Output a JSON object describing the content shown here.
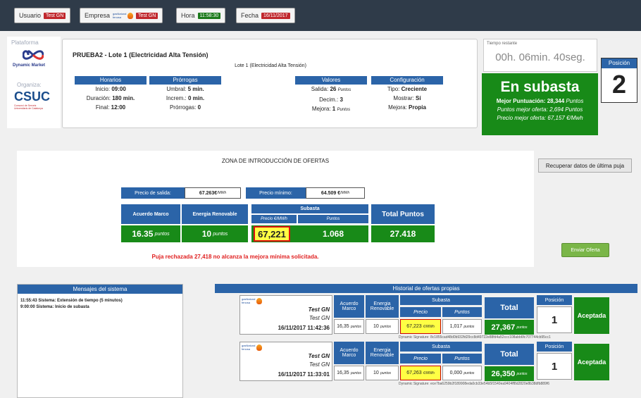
{
  "topbar": {
    "user": {
      "label": "Usuario",
      "value": "Test GN"
    },
    "company": {
      "label": "Empresa",
      "logo": "gasNatural fenosa",
      "value": "Test GN"
    },
    "time": {
      "label": "Hora",
      "value": "11:58:30"
    },
    "date": {
      "label": "Fecha",
      "value": "16/11/2017"
    }
  },
  "brand": {
    "platform_label": "Plataforma",
    "platform_name": "Dynamic Market",
    "organizer_label": "Organiza:",
    "organizer_name": "CSUC",
    "organizer_sub": "Consorci de Serveis Universitaris de Catalunya"
  },
  "auction": {
    "title": "PRUEBA2 - Lote 1 (Electricidad Alta Tensión)",
    "subtitle": "Lote 1 (Electricidad Alta Tensión)",
    "horarios": {
      "header": "Horarios",
      "inicio_label": "Inicio:",
      "inicio": "09:00",
      "duracion_label": "Duración:",
      "duracion": "180 min.",
      "final_label": "Final:",
      "final": "12:00"
    },
    "prorrogas": {
      "header": "Prórrogas",
      "umbral_label": "Umbral:",
      "umbral": "5 min.",
      "increm_label": "Increm.:",
      "increm": "0 min.",
      "prorrogas_label": "Prórrogas:",
      "prorrogas": "0"
    },
    "valores": {
      "header": "Valores",
      "salida_label": "Salida:",
      "salida": "26",
      "salida_unit": "Puntos",
      "decim_label": "Decim.:",
      "decim": "3",
      "mejora_label": "Mejora:",
      "mejora": "1",
      "mejora_unit": "Puntos"
    },
    "config": {
      "header": "Configuración",
      "tipo_label": "Tipo:",
      "tipo": "Creciente",
      "mostrar_label": "Mostrar:",
      "mostrar": "Sí",
      "mejora_label": "Mejora:",
      "mejora": "Propia"
    }
  },
  "timer": {
    "label": "Tiempo restante",
    "value": "00h. 06min. 40seg."
  },
  "status": {
    "title": "En subasta",
    "best_score_label": "Mejor Puntuación:",
    "best_score": "28,344",
    "best_score_unit": "Puntos",
    "best_offer_points_label": "Puntos mejor oferta:",
    "best_offer_points": "2,694 Puntos",
    "best_price_label": "Precio mejor oferta:",
    "best_price": "67,157 €/Mwh"
  },
  "position": {
    "label": "Posición",
    "value": "2"
  },
  "zone": {
    "title": "ZONA DE INTRODUCCIÓN DE OFERTAS",
    "recover_button": "Recuperar datos de última puja",
    "precio_salida_label": "Precio de salida:",
    "precio_salida": "67.263€",
    "precio_salida_unit": "/MWh",
    "precio_minimo_label": "Precio mínimo:",
    "precio_minimo": "64.509 €",
    "precio_minimo_unit": "/MWh",
    "acuerdo_label": "Acuerdo Marco",
    "acuerdo_value": "16.35",
    "acuerdo_unit": "puntos",
    "energia_label": "Energia Renovable",
    "energia_value": "10",
    "energia_unit": "puntos",
    "subasta_label": "Subasta",
    "precio_col": "Precio €/MWh",
    "puntos_col": "Puntos",
    "precio_input": "67,221",
    "puntos_value": "1.068",
    "total_label": "Total Puntos",
    "total_value": "27.418",
    "error": "Puja rechazada 27,418 no alcanza la mejora mínima solicitada.",
    "send_button": "Enviar Oferta"
  },
  "messages": {
    "header": "Mensajes del sistema",
    "items": [
      "11:55:43 Sistema: Extensión de tiempo (5 minutos)",
      "9:00:00 Sistema: Inicio de subasta"
    ]
  },
  "history": {
    "header": "Historial de ofertas propias",
    "col_acuerdo": "Acuerdo Marco",
    "col_energia": "Energia Renovable",
    "col_subasta": "Subasta",
    "col_precio": "Precio",
    "col_puntos": "Puntos",
    "col_total": "Total",
    "col_posicion": "Posición",
    "rows": [
      {
        "company": "Test GN",
        "user": "Test GN",
        "date": "16/11/2017 11:42:36",
        "acuerdo": "16,35",
        "acuerdo_unit": "puntos",
        "energia": "10",
        "energia_unit": "puntos",
        "precio": "67,223",
        "precio_unit": "€/MWh",
        "puntos": "1,017",
        "puntos_unit": "puntos",
        "total": "27,367",
        "total_unit": "puntos",
        "posicion": "1",
        "estado": "Aceptada",
        "signature": "Dynamic Signature: 8c1855cad48d0b932fd29cc8d49722e88fd4a52ccc108abb6fc707744cb95cc1"
      },
      {
        "company": "Test GN",
        "user": "Test GN",
        "date": "16/11/2017 11:33:01",
        "acuerdo": "16,35",
        "acuerdo_unit": "puntos",
        "energia": "10",
        "energia_unit": "puntos",
        "precio": "67,263",
        "precio_unit": "€/MWh",
        "puntos": "0,000",
        "puntos_unit": "puntos",
        "total": "26,350",
        "total_unit": "puntos",
        "posicion": "1",
        "estado": "Aceptada",
        "signature": "Dynamic Signature: ece7ba6259b2f189908eda0cb33e54b5f1540ea9404ff8d2820e8b38dfb889f6"
      }
    ]
  }
}
